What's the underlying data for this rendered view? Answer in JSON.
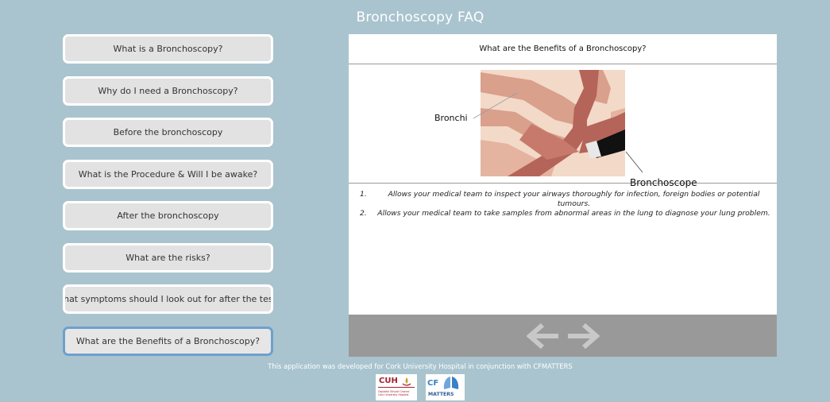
{
  "app": {
    "title": "Bronchoscopy FAQ"
  },
  "nav": {
    "items": [
      {
        "label": "What is a Bronchoscopy?"
      },
      {
        "label": "Why do I need a Bronchoscopy?"
      },
      {
        "label": "Before the bronchoscopy"
      },
      {
        "label": "What is the Procedure & Will I be awake?"
      },
      {
        "label": "After the bronchoscopy"
      },
      {
        "label": "What are the risks?"
      },
      {
        "label": "What symptoms should I look out for after the test?"
      },
      {
        "label": "What are the Benefits of a Bronchoscopy?"
      }
    ],
    "active_index": 7
  },
  "content": {
    "question": "What are the Benefits of a Bronchoscopy?",
    "illustration": {
      "label_bronchi": "Bronchi",
      "label_bronchoscope": "Bronchoscope"
    },
    "answers": [
      {
        "num": "1.",
        "text": "Allows your medical team to inspect your airways thoroughly for infection, foreign bodies or potential tumours."
      },
      {
        "num": "2.",
        "text": "Allows your medical team to take samples from abnormal areas in the lung to diagnose your lung problem."
      }
    ]
  },
  "navigation": {
    "prev_icon": "arrow-left-icon",
    "next_icon": "arrow-right-icon"
  },
  "footer": {
    "text": "This application was developed for Cork University Hospital in conjunction with CFMATTERS",
    "logo_cuh_text": "CUH",
    "logo_cuh_sub": "Ospidéal Ollscoil Chorcaí Cork University Hospital",
    "logo_cf_text": "CF",
    "logo_cf_sub": "MATTERS"
  },
  "colors": {
    "background": "#a9c4cf",
    "button_bg": "#e2e2e2",
    "active_border": "#6f9fcc",
    "nav_bar": "#999999"
  }
}
